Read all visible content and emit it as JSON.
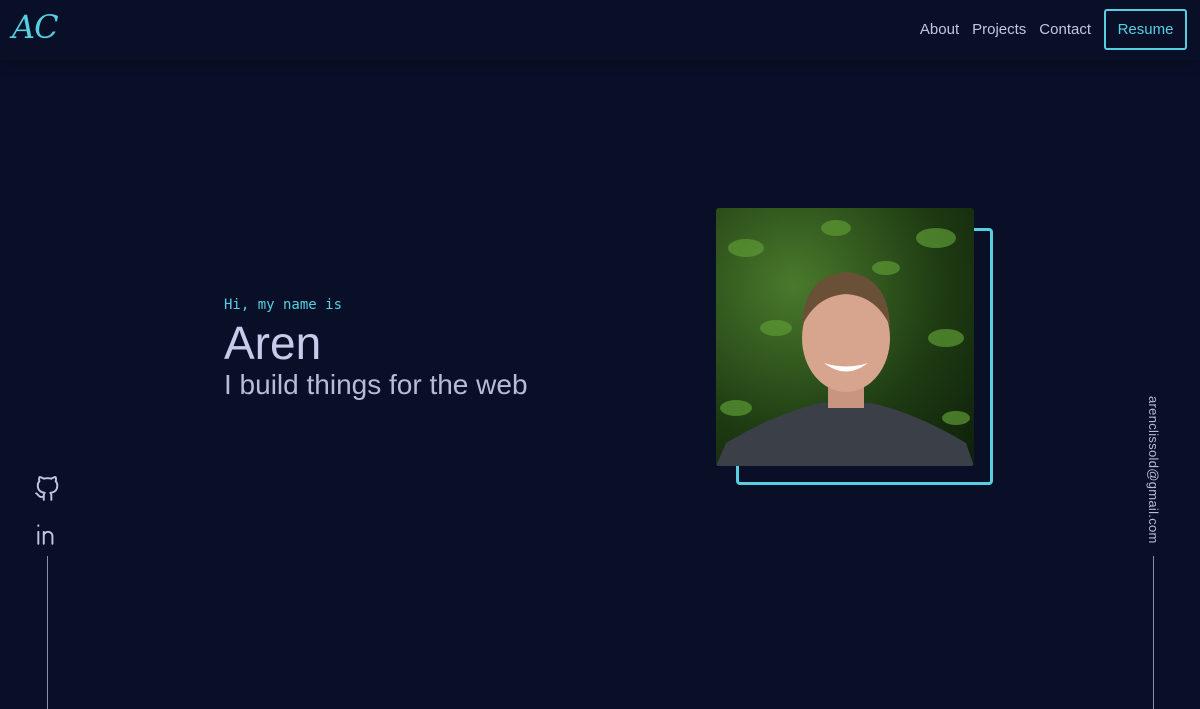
{
  "nav": {
    "logo": "AC",
    "links": [
      "About",
      "Projects",
      "Contact"
    ],
    "resume": "Resume"
  },
  "hero": {
    "greeting": "Hi, my name is",
    "name": "Aren",
    "tagline": "I build things for the web"
  },
  "social": [
    "github-icon",
    "linkedin-icon"
  ],
  "email": "arenclissold@gmail.com",
  "colors": {
    "background": "#0a0f28",
    "accent": "#56cfe1"
  }
}
